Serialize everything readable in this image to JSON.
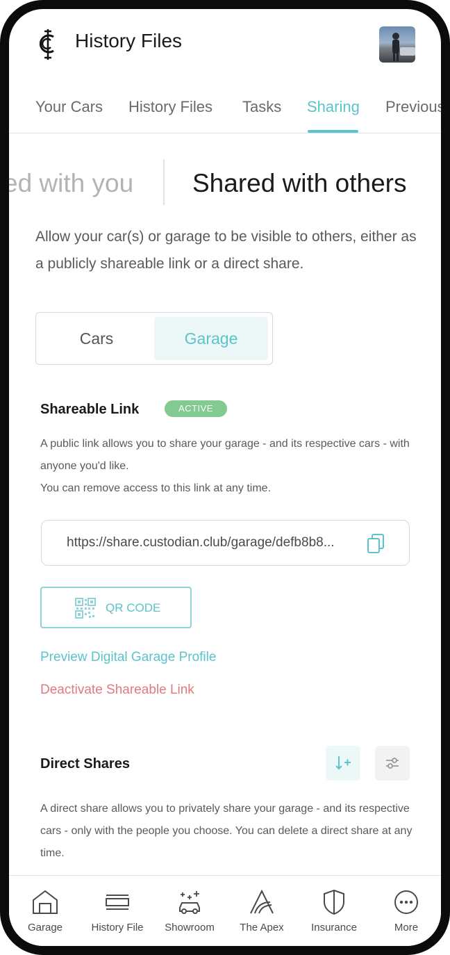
{
  "header": {
    "title": "History Files"
  },
  "tabs": [
    {
      "label": "Your Cars"
    },
    {
      "label": "History Files"
    },
    {
      "label": "Tasks"
    },
    {
      "label": "Sharing"
    },
    {
      "label": "Previous"
    }
  ],
  "subtabs": {
    "inactive": "ed with you",
    "active": "Shared with others"
  },
  "intro": "Allow your car(s) or garage to be visible to others, either as a publicly shareable link or a direct share.",
  "segment": {
    "cars": "Cars",
    "garage": "Garage",
    "selected": "Garage"
  },
  "shareable": {
    "title": "Shareable Link",
    "badge": "ACTIVE",
    "desc1": "A public link allows you to share your garage - and its respective cars - with anyone you'd like.",
    "desc2": "You can remove access to this link at any time.",
    "url": "https://share.custodian.club/garage/defb8b8...",
    "qr_label": "QR CODE",
    "preview_link": "Preview Digital Garage Profile",
    "deactivate_link": "Deactivate Shareable Link"
  },
  "direct": {
    "title": "Direct Shares",
    "desc": "A direct share allows you to privately share your garage - and its respective cars - only with the people you choose. You can delete a direct share at any time."
  },
  "nav": [
    {
      "label": "Garage",
      "icon": "garage-icon"
    },
    {
      "label": "History File",
      "icon": "history-file-icon"
    },
    {
      "label": "Showroom",
      "icon": "showroom-icon"
    },
    {
      "label": "The Apex",
      "icon": "apex-icon"
    },
    {
      "label": "Insurance",
      "icon": "shield-icon"
    },
    {
      "label": "More",
      "icon": "more-icon"
    }
  ],
  "colors": {
    "accent": "#5bc3cb",
    "danger": "#e07a7f",
    "active_badge": "#82ca8f"
  }
}
